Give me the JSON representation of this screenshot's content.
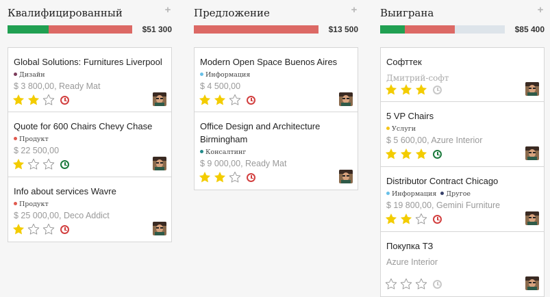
{
  "columns": [
    {
      "title": "Квалифицированный",
      "total": "$51 300",
      "progress": [
        {
          "color": "#21a052",
          "share": 0.33
        },
        {
          "color": "#dc6965",
          "share": 0.67
        }
      ],
      "cards": [
        {
          "title": "Global Solutions: Furnitures Liverpool",
          "tags": [
            {
              "label": "Дизайн",
              "color": "#7b3b5a"
            }
          ],
          "revenue": "$ 3 800,00, Ready Mat",
          "stars": 2,
          "activity": "overdue"
        },
        {
          "title": "Quote for 600 Chairs Chevy Chase",
          "tags": [
            {
              "label": "Продукт",
              "color": "#e05a4f"
            }
          ],
          "revenue": "$ 22 500,00",
          "stars": 1,
          "activity": "planned"
        },
        {
          "title": "Info about services Wavre",
          "tags": [
            {
              "label": "Продукт",
              "color": "#e05a4f"
            }
          ],
          "revenue": "$ 25 000,00, Deco Addict",
          "stars": 1,
          "activity": "overdue"
        }
      ]
    },
    {
      "title": "Предложение",
      "total": "$13 500",
      "progress": [
        {
          "color": "#dc6965",
          "share": 1.0
        }
      ],
      "cards": [
        {
          "title": "Modern Open Space Buenos Aires",
          "tags": [
            {
              "label": "Информация",
              "color": "#68c0e8"
            }
          ],
          "revenue": "$ 4 500,00",
          "stars": 2,
          "activity": "overdue"
        },
        {
          "title": "Office Design and Architecture Birmingham",
          "tags": [
            {
              "label": "Консалтинг",
              "color": "#238a8a"
            }
          ],
          "revenue": "$ 9 000,00, Ready Mat",
          "stars": 2,
          "activity": "overdue"
        }
      ]
    },
    {
      "title": "Выиграна",
      "total": "$85 400",
      "progress": [
        {
          "color": "#21a052",
          "share": 0.2
        },
        {
          "color": "#dc6965",
          "share": 0.4
        },
        {
          "color": "#dde4ea",
          "share": 0.4
        }
      ],
      "cards": [
        {
          "title": "Софттек",
          "tags": [],
          "revenue": "Дмитрий-софт",
          "stars": 3,
          "activity": "none"
        },
        {
          "title": "5 VP Chairs",
          "tags": [
            {
              "label": "Услуги",
              "color": "#f5c518"
            }
          ],
          "revenue": "$ 5 600,00, Azure Interior",
          "stars": 3,
          "activity": "planned"
        },
        {
          "title": "Distributor Contract Chicago",
          "tags": [
            {
              "label": "Информация",
              "color": "#68c0e8"
            },
            {
              "label": "Другое",
              "color": "#37406a"
            }
          ],
          "revenue": "$ 19 800,00, Gemini Furniture",
          "stars": 2,
          "activity": "overdue"
        },
        {
          "title": "Покупка ТЗ",
          "tags": [],
          "revenue": "Azure Interior",
          "stars": 0,
          "activity": "none"
        }
      ]
    }
  ]
}
